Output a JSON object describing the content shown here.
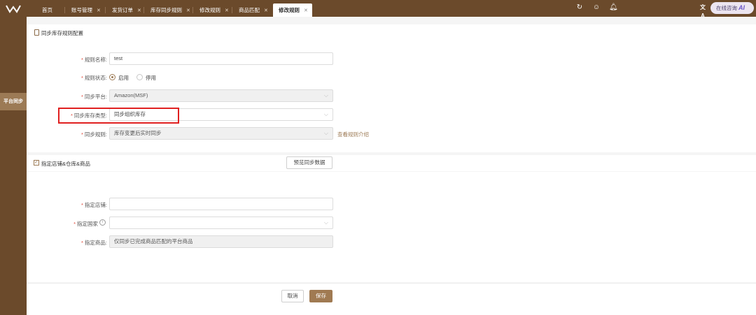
{
  "tabs": [
    {
      "label": "首页",
      "closable": false
    },
    {
      "label": "账号管理",
      "closable": true
    },
    {
      "label": "发货订单",
      "closable": true
    },
    {
      "label": "库存同步规则",
      "closable": true
    },
    {
      "label": "修改规则",
      "closable": true
    },
    {
      "label": "商品匹配",
      "closable": true
    },
    {
      "label": "修改规则",
      "closable": true,
      "active": true
    }
  ],
  "header": {
    "icons": [
      "refresh-icon",
      "smiley-icon",
      "bell-icon",
      "translate-icon"
    ],
    "consult_label": "在线咨询",
    "consult_ai": "AI"
  },
  "sidebar": {
    "active_item": "平台同步"
  },
  "section1": {
    "title": "同步库存规则配置",
    "rule_name": {
      "label": "规则名称:",
      "value": "test"
    },
    "rule_status": {
      "label": "规则状态:",
      "options": [
        "启用",
        "停用"
      ],
      "selected": "启用"
    },
    "platform": {
      "label": "同步平台:",
      "value": "Amazon(MSF)"
    },
    "inventory_type": {
      "label": "同步库存类型:",
      "value": "同步组织库存"
    },
    "sync_rule": {
      "label": "同步规则:",
      "value": "库存变更后实时同步",
      "link": "查看规则介绍"
    }
  },
  "section2": {
    "title": "指定店铺&仓库&商品",
    "preview_button": "预览同步数据",
    "shop": {
      "label": "指定店铺:",
      "value": ""
    },
    "country": {
      "label": "指定国家",
      "value": ""
    },
    "product": {
      "label": "指定商品:",
      "value": "仅同步已完成商品匹配的平台商品"
    }
  },
  "footer": {
    "cancel": "取消",
    "save": "保存"
  },
  "colors": {
    "brand": "#6b4a2b",
    "accent": "#9c7a55",
    "highlight": "#e02020"
  }
}
